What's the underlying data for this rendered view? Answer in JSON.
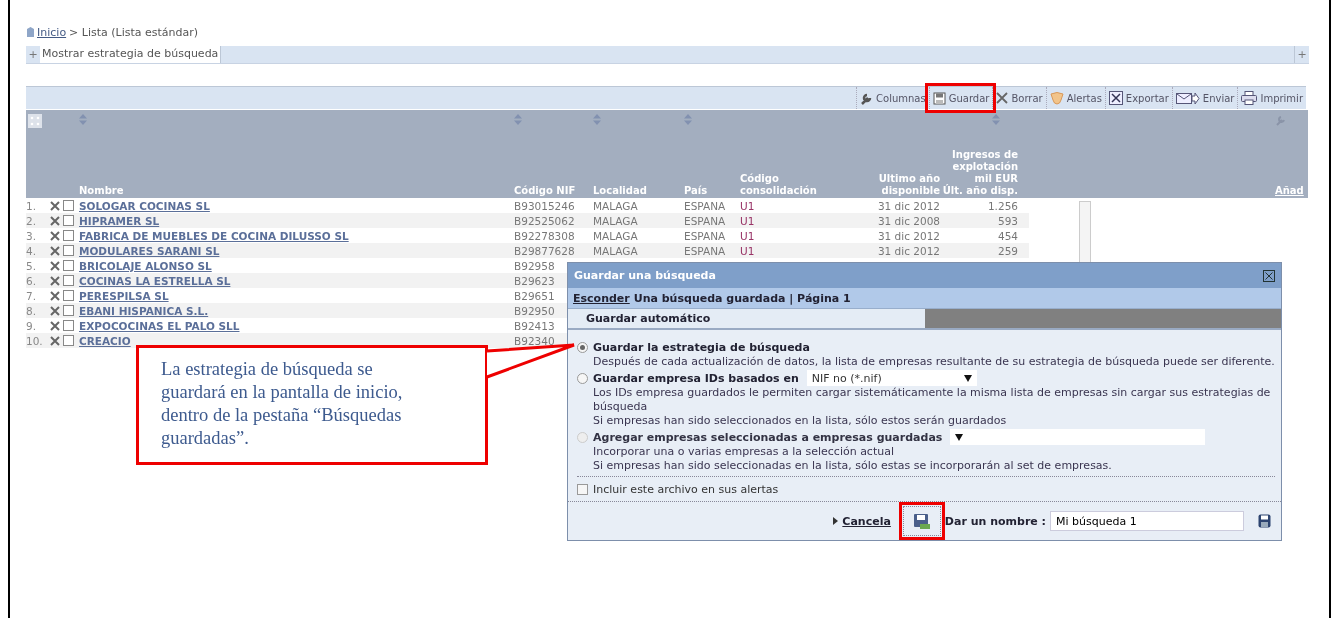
{
  "breadcrumb": {
    "home": "Inicio",
    "current": "> Lista (Lista estándar)"
  },
  "strategy_bar": {
    "toggle": "+",
    "label": "Mostrar estrategia de búsqueda",
    "right_toggle": "+"
  },
  "toolbar": [
    {
      "label": "Columnas",
      "highlighted": false
    },
    {
      "label": "Guardar",
      "highlighted": true
    },
    {
      "label": "Borrar",
      "highlighted": false
    },
    {
      "label": "Alertas",
      "highlighted": false
    },
    {
      "label": "Exportar",
      "highlighted": false
    },
    {
      "label": "Enviar",
      "highlighted": false
    },
    {
      "label": "Imprimir",
      "highlighted": false
    }
  ],
  "table": {
    "columns": [
      {
        "label": "Nombre",
        "sortable": true
      },
      {
        "label": "Código NIF",
        "sortable": true
      },
      {
        "label": "Localidad",
        "sortable": true
      },
      {
        "label": "País",
        "sortable": true
      },
      {
        "label": "Código\nconsolidación",
        "sortable": false
      },
      {
        "label": "Ultimo año\ndisponible",
        "sortable": false
      },
      {
        "label": "Ingresos de\nexplotación\nmil EUR\nÚlt. año disp.",
        "sortable": true
      }
    ],
    "extra_column": "Añad",
    "rows": [
      {
        "index": "1.",
        "name": "SOLOGAR COCINAS SL",
        "nif": "B93015246",
        "locality": "MALAGA",
        "country": "ESPANA",
        "code": "U1",
        "year": "31 dic 2012",
        "revenue": "1.256",
        "checked": false
      },
      {
        "index": "2.",
        "name": "HIPRAMER SL",
        "nif": "B92525062",
        "locality": "MALAGA",
        "country": "ESPANA",
        "code": "U1",
        "year": "31 dic 2008",
        "revenue": "593",
        "checked": false
      },
      {
        "index": "3.",
        "name": "FABRICA DE MUEBLES DE COCINA DILUSSO SL",
        "nif": "B92278308",
        "locality": "MALAGA",
        "country": "ESPANA",
        "code": "U1",
        "year": "31 dic 2012",
        "revenue": "454",
        "checked": false
      },
      {
        "index": "4.",
        "name": "MODULARES SARANI SL",
        "nif": "B29877628",
        "locality": "MALAGA",
        "country": "ESPANA",
        "code": "U1",
        "year": "31 dic 2012",
        "revenue": "259",
        "checked": false
      },
      {
        "index": "5.",
        "name": "BRICOLAJE ALONSO SL",
        "nif": "B92958",
        "checked": false
      },
      {
        "index": "6.",
        "name": "COCINAS LA ESTRELLA SL",
        "nif": "B29623",
        "checked": false
      },
      {
        "index": "7.",
        "name": "PERESPILSA SL",
        "nif": "B29651",
        "checked": false
      },
      {
        "index": "8.",
        "name": "EBANI HISPANICA S.L.",
        "nif": "B92950",
        "checked": false
      },
      {
        "index": "9.",
        "name": "EXPOCOCINAS EL PALO SLL",
        "nif": "B92413",
        "checked": false
      },
      {
        "index": "10.",
        "name": "CREACIO",
        "nif": "B92340",
        "checked": false
      }
    ]
  },
  "dialog": {
    "title": "Guardar una búsqueda",
    "hide_link": "Esconder",
    "subtitle": "Una búsqueda guardada | Página 1",
    "tab": "Guardar automático",
    "options": [
      {
        "kind": "plain",
        "label": "Guardar la estrategia de búsqueda",
        "selected": true,
        "disabled": false,
        "description": [
          "Después de cada actualización de datos, la lista de empresas resultante de su estrategia de búsqueda puede ser diferente."
        ]
      },
      {
        "kind": "select",
        "label": "Guardar empresa IDs basados en",
        "select_value": "NIF no (*.nif)",
        "selected": false,
        "disabled": false,
        "description": [
          "Los IDs empresa guardados le permiten cargar sistemáticamente la misma lista de empresas sin cargar sus estrategias de búsqueda",
          "Si empresas han sido seleccionados en la lista, sólo estos serán guardados"
        ]
      },
      {
        "kind": "select",
        "label": "Agregar empresas seleccionadas a empresas guardadas",
        "selected": false,
        "disabled": true,
        "description": [
          "Incorporar una o varias empresas a la selección actual",
          "Si empresas han sido seleccionadas en la lista, sólo estas se incorporarán al set de empresas."
        ]
      }
    ],
    "alerts_checkbox": {
      "label": "Incluir este archivo en sus alertas",
      "checked": false
    },
    "footer": {
      "cancel": "Cancela",
      "save_highlighted": true,
      "name_label": "Dar un nombre :",
      "name_value": "Mi búsqueda 1"
    }
  },
  "callout": {
    "text": "La estrategia de búsqueda se guardará en la pantalla de inicio, dentro de la pestaña “Búsquedas guardadas”."
  }
}
